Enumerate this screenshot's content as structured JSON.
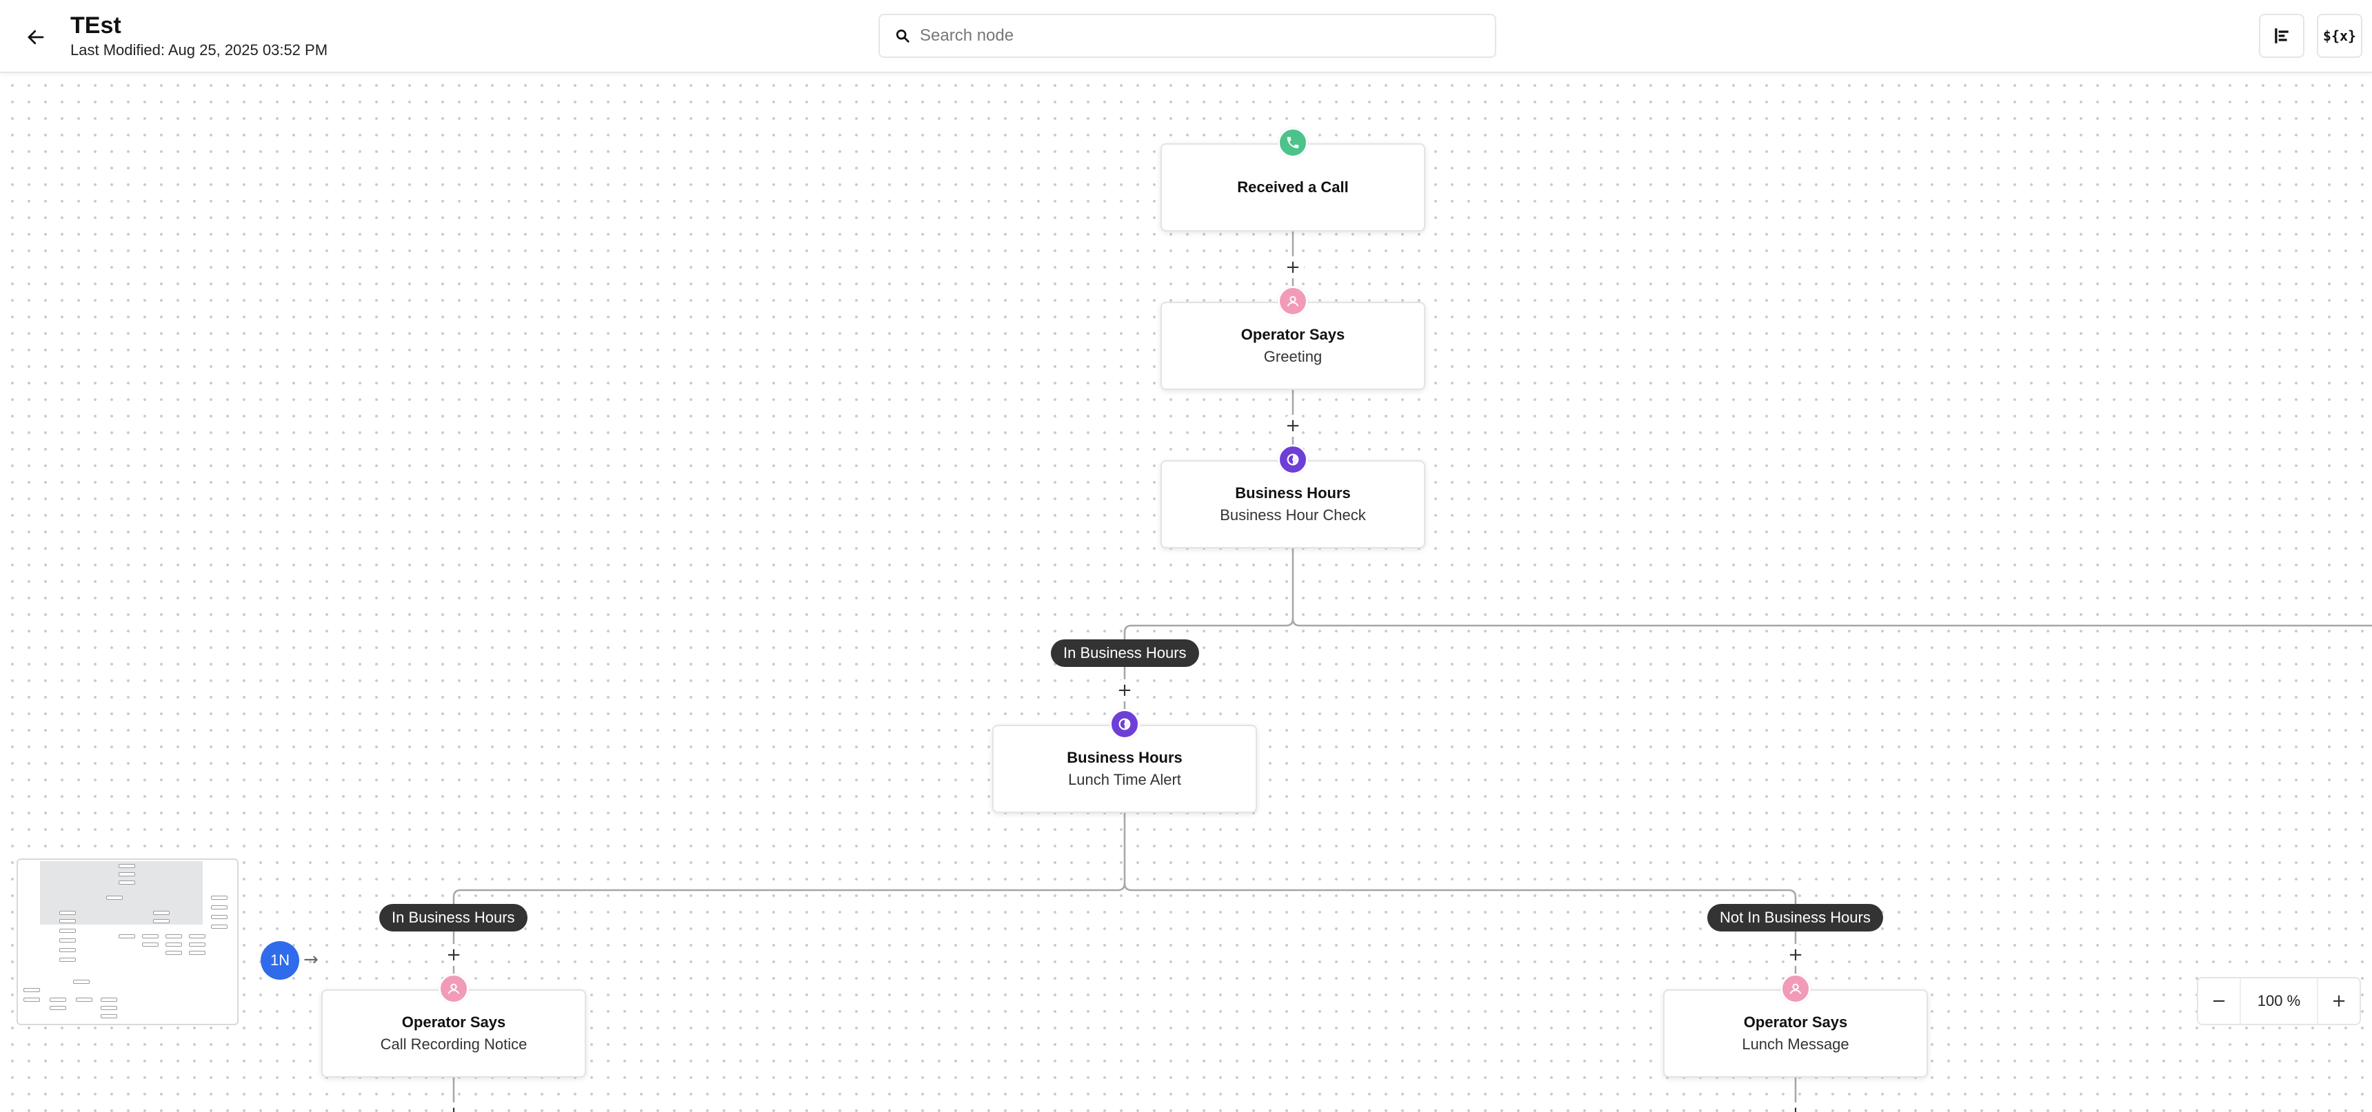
{
  "header": {
    "title": "TEst",
    "last_modified": "Last Modified: Aug 25, 2025 03:52 PM",
    "search_placeholder": "Search node",
    "vars_button_label": "${x}"
  },
  "nodes": {
    "received_call": {
      "title": "Received a Call",
      "icon": "phone-icon"
    },
    "operator_greeting": {
      "title": "Operator Says",
      "subtitle": "Greeting",
      "icon": "operator-icon"
    },
    "business_hour_check": {
      "title": "Business Hours",
      "subtitle": "Business Hour Check",
      "icon": "business-hours-icon"
    },
    "lunch_time_alert": {
      "title": "Business Hours",
      "subtitle": "Lunch Time Alert",
      "icon": "business-hours-icon"
    },
    "call_recording_notice": {
      "title": "Operator Says",
      "subtitle": "Call Recording Notice",
      "icon": "operator-icon"
    },
    "lunch_message": {
      "title": "Operator Says",
      "subtitle": "Lunch Message",
      "icon": "operator-icon"
    }
  },
  "branches": {
    "in_business_hours_1": "In Business Hours",
    "in_business_hours_2": "In Business Hours",
    "not_in_business_hours": "Not In Business Hours"
  },
  "badge": {
    "label": "1N",
    "color": "#2f6bea"
  },
  "zoom": {
    "value": "100 %"
  },
  "colors": {
    "phone_icon": "#4cc38a",
    "operator_icon": "#f19bb8",
    "business_hours_icon": "#6d3fd6",
    "branch_pill": "#333333"
  }
}
